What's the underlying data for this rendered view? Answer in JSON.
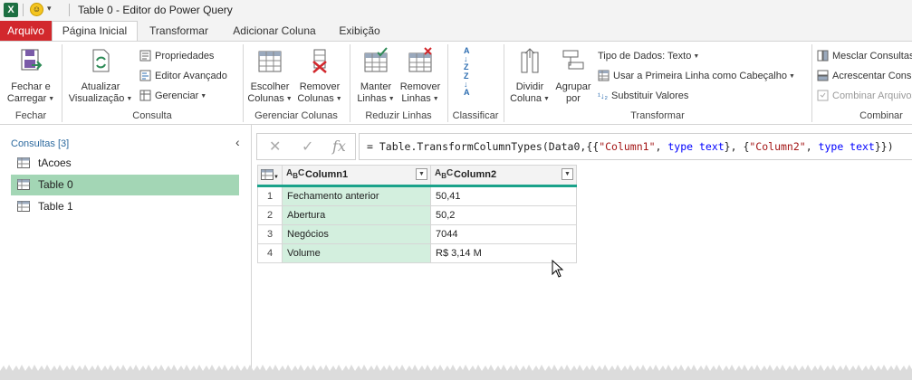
{
  "window": {
    "app_icon_letter": "X",
    "title": "Table 0 - Editor do Power Query",
    "brand_color": "#d2282d",
    "accent_color": "#1aa28a"
  },
  "tabs": [
    {
      "label": "Arquivo"
    },
    {
      "label": "Página Inicial"
    },
    {
      "label": "Transformar"
    },
    {
      "label": "Adicionar Coluna"
    },
    {
      "label": "Exibição"
    }
  ],
  "ribbon": {
    "groups": {
      "fechar": "Fechar",
      "consulta": "Consulta",
      "gerenciar_colunas": "Gerenciar Colunas",
      "reduzir_linhas": "Reduzir Linhas",
      "classificar": "Classificar",
      "transformar": "Transformar",
      "combinar": "Combinar"
    },
    "fechar_carregar": [
      "Fechar e",
      "Carregar"
    ],
    "atualizar": [
      "Atualizar",
      "Visualização"
    ],
    "propriedades": "Propriedades",
    "editor_avancado": "Editor Avançado",
    "gerenciar": "Gerenciar",
    "escolher_colunas": [
      "Escolher",
      "Colunas"
    ],
    "remover_colunas": [
      "Remover",
      "Colunas"
    ],
    "manter_linhas": [
      "Manter",
      "Linhas"
    ],
    "remover_linhas": [
      "Remover",
      "Linhas"
    ],
    "dividir_coluna": [
      "Dividir",
      "Coluna"
    ],
    "agrupar_por": [
      "Agrupar",
      "por"
    ],
    "tipo_dados": "Tipo de Dados: Texto",
    "primeira_linha": "Usar a Primeira Linha como Cabeçalho",
    "substituir_valores": "Substituir Valores",
    "mesclar_consultas": "Mesclar Consultas",
    "acrescentar_consultas": "Acrescentar Consultas",
    "combinar_arquivos": "Combinar Arquivos"
  },
  "queries": {
    "header": "Consultas [3]",
    "items": [
      {
        "label": "tAcoes",
        "selected": false
      },
      {
        "label": "Table 0",
        "selected": true
      },
      {
        "label": "Table 1",
        "selected": false
      }
    ]
  },
  "formula": {
    "fx": "fx",
    "prefix": "= Table.TransformColumnTypes(Data0,{{",
    "col1": "\"Column1\"",
    "sep1": ", ",
    "type1": "type text",
    "mid": "}, {",
    "col2": "\"Column2\"",
    "sep2": ", ",
    "type2": "type text",
    "suffix": "}})"
  },
  "grid": {
    "type_icon": "ABC",
    "columns": [
      "Column1",
      "Column2"
    ],
    "rows": [
      {
        "n": "1",
        "c1": "Fechamento anterior",
        "c2": "50,41"
      },
      {
        "n": "2",
        "c1": "Abertura",
        "c2": "50,2"
      },
      {
        "n": "3",
        "c1": "Negócios",
        "c2": "7044"
      },
      {
        "n": "4",
        "c1": "Volume",
        "c2": "R$ 3,14 M"
      }
    ]
  }
}
